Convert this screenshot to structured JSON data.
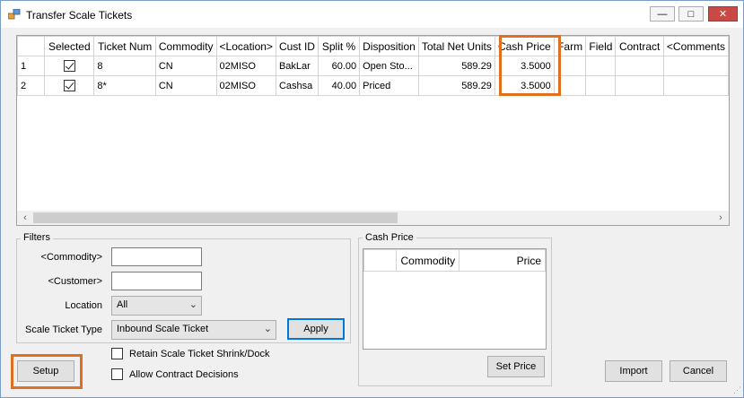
{
  "window": {
    "title": "Transfer Scale Tickets",
    "minimize": "—",
    "maximize": "□",
    "close": "✕"
  },
  "grid": {
    "columns": [
      "",
      "Selected",
      "Ticket Num",
      "Commodity",
      "<Location>",
      "Cust ID",
      "Split %",
      "Disposition",
      "Total Net Units",
      "Cash Price",
      "Farm",
      "Field",
      "Contract",
      "<Comments"
    ],
    "rows": [
      {
        "row": "1",
        "selected": true,
        "ticket": "8",
        "commodity": "CN",
        "location": "02MISO",
        "cust": "BakLar",
        "split": "60.00",
        "disposition": "Open Sto...",
        "net_units": "589.29",
        "cash_price": "3.5000",
        "farm": "",
        "field": "",
        "contract": "",
        "comments": ""
      },
      {
        "row": "2",
        "selected": true,
        "ticket": "8*",
        "commodity": "CN",
        "location": "02MISO",
        "cust": "Cashsa",
        "split": "40.00",
        "disposition": "Priced",
        "net_units": "589.29",
        "cash_price": "3.5000",
        "farm": "",
        "field": "",
        "contract": "",
        "comments": ""
      }
    ]
  },
  "filters": {
    "title": "Filters",
    "commodity_label": "<Commodity>",
    "commodity_value": "",
    "customer_label": "<Customer>",
    "customer_value": "",
    "location_label": "Location",
    "location_value": "All",
    "ticket_type_label": "Scale Ticket Type",
    "ticket_type_value": "Inbound Scale Ticket",
    "apply": "Apply"
  },
  "options": {
    "retain_shrink": "Retain Scale Ticket Shrink/Dock",
    "allow_contract": "Allow Contract Decisions"
  },
  "cash_price": {
    "title": "Cash Price",
    "columns": [
      "",
      "Commodity",
      "Price"
    ],
    "set_price": "Set Price"
  },
  "buttons": {
    "setup": "Setup",
    "import": "Import",
    "cancel": "Cancel"
  },
  "colors": {
    "highlight": "#e07020",
    "close_button": "#c94a44",
    "primary_border": "#0078d7"
  }
}
